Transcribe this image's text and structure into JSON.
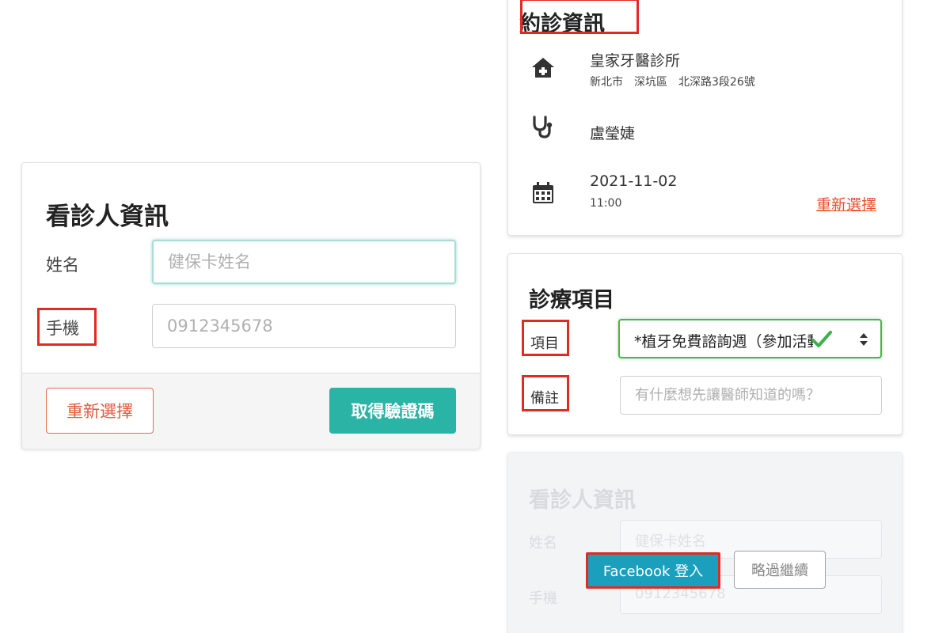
{
  "patient_form": {
    "title": "看診人資訊",
    "name_label": "姓名",
    "name_placeholder": "健保卡姓名",
    "phone_label": "手機",
    "phone_placeholder": "0912345678",
    "reselect_label": "重新選擇",
    "get_code_label": "取得驗證碼"
  },
  "appointment": {
    "title": "約診資訊",
    "clinic_name": "皇家牙醫診所",
    "clinic_address": "新北市　深坑區　北深路3段26號",
    "doctor": "盧瑩婕",
    "date": "2021-11-02",
    "time": "11:00",
    "reselect_label": "重新選擇"
  },
  "treatment": {
    "title": "診療項目",
    "item_label": "項目",
    "item_selected": "*植牙免費諮詢週（參加活動",
    "note_label": "備註",
    "note_placeholder": "有什麼想先讓醫師知道的嗎？"
  },
  "faded_patient_form": {
    "title": "看診人資訊",
    "name_label": "姓名",
    "name_placeholder": "健保卡姓名",
    "phone_label": "手機",
    "phone_placeholder": "0912345678"
  },
  "login": {
    "facebook_label": "Facebook 登入",
    "skip_label": "略過繼續"
  },
  "colors": {
    "accent_teal": "#2ab4a6",
    "accent_orange": "#e8512e",
    "facebook_blue": "#1a9fbd",
    "valid_green": "#4db24d",
    "highlight_red": "#e02a22"
  }
}
